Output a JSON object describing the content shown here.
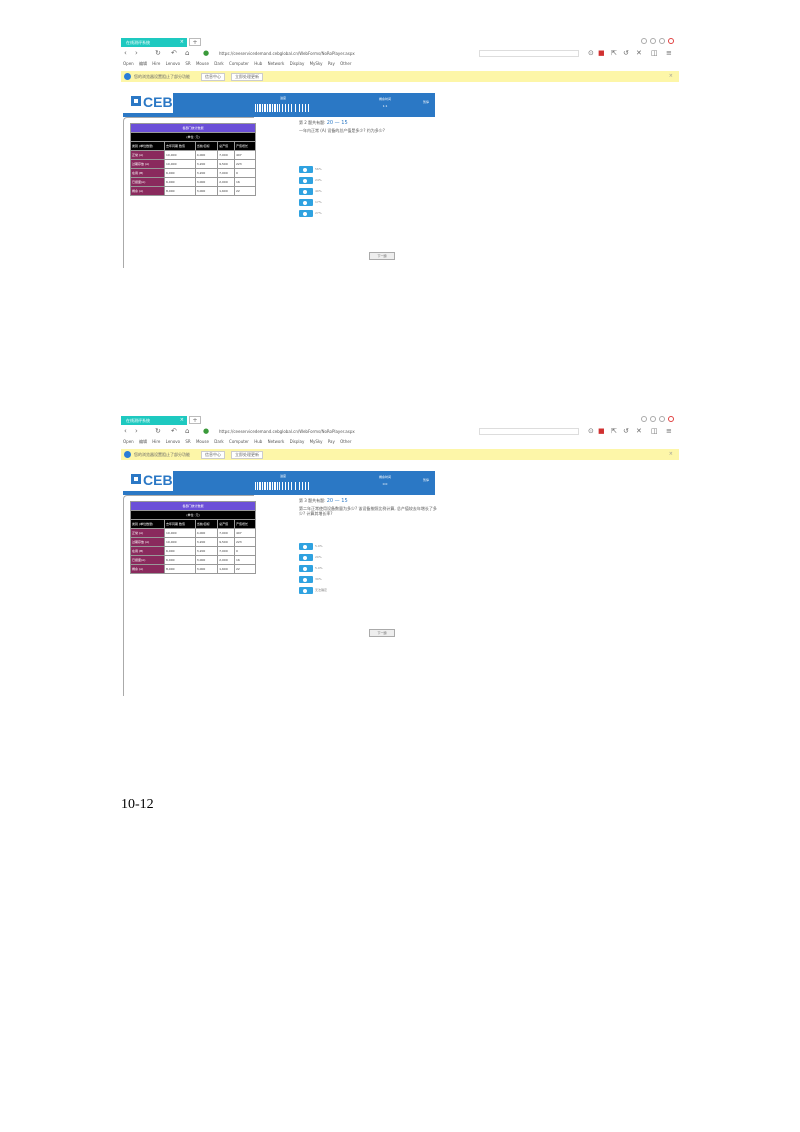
{
  "browser": {
    "tab_label": "在线测评系统",
    "url": "https://ceeservicedemand.cebglobal.cn/WebForms/NoRoPlayer.aspx",
    "search_placeholder": "",
    "bookmarks": [
      "Open",
      "编辑",
      "Hire",
      "Lenovo",
      "SR",
      "Mouse",
      "Dark",
      "Computer",
      "Hub",
      "Network",
      "Display",
      "MySky",
      "Pay",
      "Other"
    ]
  },
  "notification": {
    "message": "您的浏览器设置阻止了部分功能",
    "button1": "信息中心",
    "button2": "立即处理更新"
  },
  "ceb": {
    "logo": "CEB",
    "progress_label": "进度",
    "timer_label": "剩余时间",
    "timer_value_1": "1:1",
    "timer_value_2": "0:0",
    "pause": "暂停"
  },
  "table": {
    "title": "各部门统计数据",
    "subtitle": "(单位: 元)",
    "headers": [
      "类别\n(单位数量)",
      "去年同期\n数值",
      "当前/目标",
      "总产值",
      "产值增长"
    ],
    "rows": [
      {
        "label": "正常 (A)",
        "cells": [
          "10,000",
          "4,000",
          "7,000",
          "407"
        ]
      },
      {
        "label": "过期存放 (A)",
        "cells": [
          "10,000",
          "3,200",
          "9,500",
          "223"
        ]
      },
      {
        "label": "在用 (B)",
        "cells": [
          "6,000",
          "3,200",
          "7,000",
          "0"
        ]
      },
      {
        "label": "已报废(A)",
        "cells": [
          "6,000",
          "3,000",
          "2,000",
          "16"
        ]
      },
      {
        "label": "剩余 (A)",
        "cells": [
          "8,000",
          "3,000",
          "1,600",
          "22"
        ]
      }
    ]
  },
  "questions": [
    {
      "number_label": "第 2 题共有题: ",
      "number_value": "20 — 15",
      "text": "一年内正常 (A) 设备的总产值是多少? 约为多少?",
      "options": [
        "56%",
        "24%",
        "40%",
        "17%",
        "27%"
      ],
      "next_label": "下一题"
    },
    {
      "number_label": "第 3 题共有题: ",
      "number_value": "20 — 15",
      "text": "第二年正常使用设备数量为多少? 该设备按照比例计算, 总产值较去年增长了多少? 计算其增长率?",
      "options": [
        "5.0%",
        "20%",
        "5.0%",
        "30%",
        "无法确定"
      ],
      "next_label": "下一题"
    }
  ],
  "page_number": "10-12"
}
